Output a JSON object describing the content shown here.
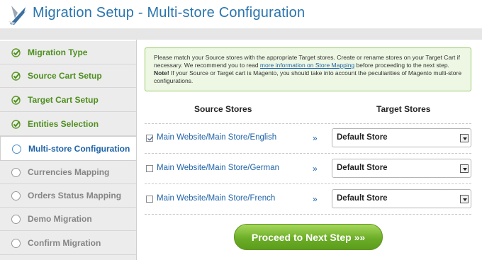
{
  "header": {
    "title": "Migration Setup - Multi-store Configuration",
    "logo_icon": "arrow-logo-icon"
  },
  "colors": {
    "title": "#2a75ad",
    "done_step": "#4f8f1f",
    "active_step": "#1f63a8",
    "todo_step": "#858585",
    "notice_bg": "#edf7e4",
    "notice_border": "#9acb6a",
    "button_green": "#6cae27"
  },
  "sidebar": {
    "steps": [
      {
        "label": "Migration Type",
        "status": "done",
        "icon": "check-icon"
      },
      {
        "label": "Source Cart Setup",
        "status": "done",
        "icon": "check-icon"
      },
      {
        "label": "Target Cart Setup",
        "status": "done",
        "icon": "check-icon"
      },
      {
        "label": "Entities Selection",
        "status": "done",
        "icon": "check-icon"
      },
      {
        "label": "Multi-store Configuration",
        "status": "active",
        "icon": "circle-icon"
      },
      {
        "label": "Currencies Mapping",
        "status": "todo",
        "icon": "circle-icon"
      },
      {
        "label": "Orders Status Mapping",
        "status": "todo",
        "icon": "circle-icon"
      },
      {
        "label": "Demo Migration",
        "status": "todo",
        "icon": "circle-icon"
      },
      {
        "label": "Confirm Migration",
        "status": "todo",
        "icon": "circle-icon"
      }
    ]
  },
  "notice": {
    "text_before_link": "Please match your Source stores with the appropriate Target stores. Create or rename stores on your Target Cart if necessary. We recommend you to read ",
    "link": "more information on Store Mapping",
    "text_after_link": " before proceeding to the next step.",
    "note_label": "Note!",
    "note_text": " If your Source or Target cart is Magento, you should take into account the peculiarities of Magento multi-store configurations."
  },
  "table": {
    "source_header": "Source Stores",
    "target_header": "Target Stores",
    "arrow": "»",
    "rows": [
      {
        "source": "Main Website/Main Store/English",
        "checked": true,
        "target": "Default Store"
      },
      {
        "source": "Main Website/Main Store/German",
        "checked": false,
        "target": "Default Store"
      },
      {
        "source": "Main Website/Main Store/French",
        "checked": false,
        "target": "Default Store"
      }
    ]
  },
  "proceed_button": {
    "label": "Proceed to Next Step »»"
  }
}
